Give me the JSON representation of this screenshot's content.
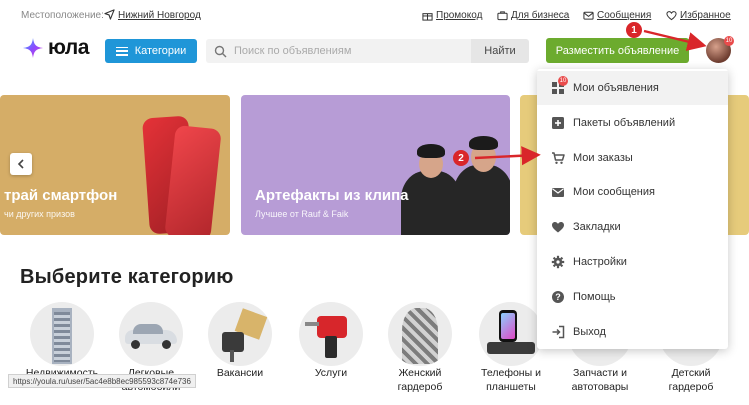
{
  "topbar": {
    "location_label": "Местоположение:",
    "city": "Нижний Новгород",
    "links": [
      {
        "label": "Промокод",
        "icon": "gift-icon"
      },
      {
        "label": "Для бизнеса",
        "icon": "briefcase-icon"
      },
      {
        "label": "Сообщения",
        "icon": "mail-icon"
      },
      {
        "label": "Избранное",
        "icon": "heart-icon"
      }
    ]
  },
  "header": {
    "logo_text": "юла",
    "categories_label": "Категории",
    "search_placeholder": "Поиск по объявлениям",
    "find_label": "Найти",
    "post_label": "Разместить объявление",
    "avatar_badge": "10"
  },
  "banners": [
    {
      "title": "трай смартфон",
      "subtitle": "чи других призов"
    },
    {
      "title": "Артефакты из клипа",
      "subtitle": "Лучшее от Rauf & Faik"
    }
  ],
  "section_title": "Выберите категорию",
  "categories": [
    {
      "label_1": "Недвижимость",
      "label_2": ""
    },
    {
      "label_1": "Легковые",
      "label_2": "автомобили"
    },
    {
      "label_1": "Вакансии",
      "label_2": ""
    },
    {
      "label_1": "Услуги",
      "label_2": ""
    },
    {
      "label_1": "Женский",
      "label_2": "гардероб"
    },
    {
      "label_1": "Телефоны и",
      "label_2": "планшеты"
    },
    {
      "label_1": "Запчасти и",
      "label_2": "автотовары"
    },
    {
      "label_1": "Детский",
      "label_2": "гардероб"
    }
  ],
  "status_url": "https://youla.ru/user/5ac4e8b8ec985593c874e736",
  "dropdown": {
    "items": [
      {
        "label": "Мои объявления",
        "icon": "listings-icon",
        "badge": "10"
      },
      {
        "label": "Пакеты объявлений",
        "icon": "package-plus-icon"
      },
      {
        "label": "Мои заказы",
        "icon": "cart-icon"
      },
      {
        "label": "Мои сообщения",
        "icon": "envelope-icon"
      },
      {
        "label": "Закладки",
        "icon": "heart-icon"
      },
      {
        "label": "Настройки",
        "icon": "gear-icon"
      },
      {
        "label": "Помощь",
        "icon": "help-icon"
      },
      {
        "label": "Выход",
        "icon": "logout-icon"
      }
    ]
  },
  "annotations": {
    "marker_1": "1",
    "marker_2": "2"
  },
  "colors": {
    "categories_button": "#1f96d8",
    "post_button": "#6cab2e",
    "annotation": "#d9262a"
  }
}
